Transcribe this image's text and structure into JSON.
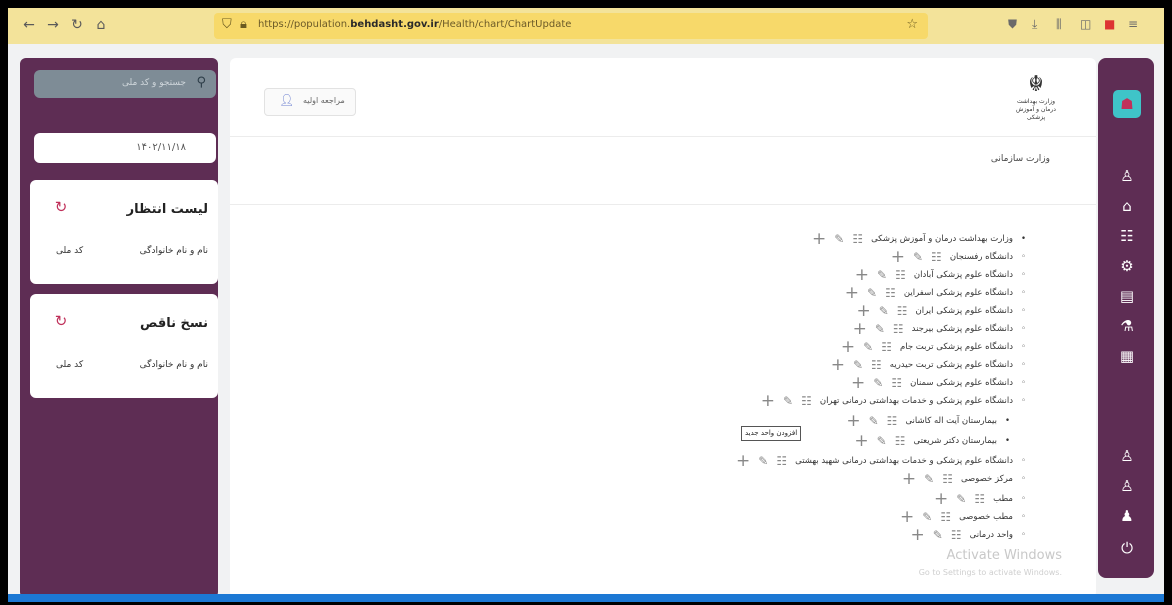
{
  "browser": {
    "url_prefix": "https://population.",
    "url_domain": "behdasht.gov.ir",
    "url_suffix": "/Health/chart/ChartUpdate"
  },
  "left": {
    "search_placeholder": "جستجو و کد ملی",
    "date": "۱۴۰۲/۱۱/۱۸",
    "cards": [
      {
        "title": "لیست انتظار",
        "col_name": "نام و نام خانوادگی",
        "col_id": "کد ملی"
      },
      {
        "title": "نسخ ناقص",
        "col_name": "نام و نام خانوادگی",
        "col_id": "کد ملی"
      }
    ]
  },
  "main": {
    "back_label": "مراجعه اولیه",
    "emblem_line1": "وزارت بهداشت",
    "emblem_line2": "درمان و آموزش پزشکی",
    "page_title": "وزارت سازمانی",
    "tree": [
      {
        "label": "وزارت بهداشت درمان و آموزش پزشکی",
        "bullet": "•"
      },
      {
        "label": "دانشگاه رفسنجان",
        "bullet": "◦"
      },
      {
        "label": "دانشگاه علوم پزشکی آبادان",
        "bullet": "◦"
      },
      {
        "label": "دانشگاه علوم پزشکی اسفراین",
        "bullet": "◦"
      },
      {
        "label": "دانشگاه علوم پزشکی ایران",
        "bullet": "◦"
      },
      {
        "label": "دانشگاه علوم پزشکی بیرجند",
        "bullet": "◦"
      },
      {
        "label": "دانشگاه علوم پزشکی تربت جام",
        "bullet": "◦"
      },
      {
        "label": "دانشگاه علوم پزشکی تربت حیدریه",
        "bullet": "◦"
      },
      {
        "label": "دانشگاه علوم پزشکی سمنان",
        "bullet": "◦"
      },
      {
        "label": "دانشگاه علوم پزشکی و خدمات بهداشتی درمانی تهران",
        "bullet": "◦"
      },
      {
        "label": "بیمارستان آیت اله کاشانی",
        "bullet": "•"
      },
      {
        "label": "بیمارستان دکتر شریعتی",
        "bullet": "•"
      },
      {
        "label": "دانشگاه علوم پزشکی و خدمات بهداشتی درمانی شهید بهشتی",
        "bullet": "◦"
      },
      {
        "label": "مرکز خصوصی",
        "bullet": "◦"
      },
      {
        "label": "مطب",
        "bullet": "◦"
      },
      {
        "label": "مطب خصوصی",
        "bullet": "◦"
      },
      {
        "label": "واحد درمانی",
        "bullet": "◦"
      }
    ],
    "tooltip": "افزودن واحد جدید",
    "watermark_title": "Activate Windows",
    "watermark_sub": "Go to Settings to activate Windows."
  },
  "icons": {
    "accent": "#5e2d54"
  }
}
